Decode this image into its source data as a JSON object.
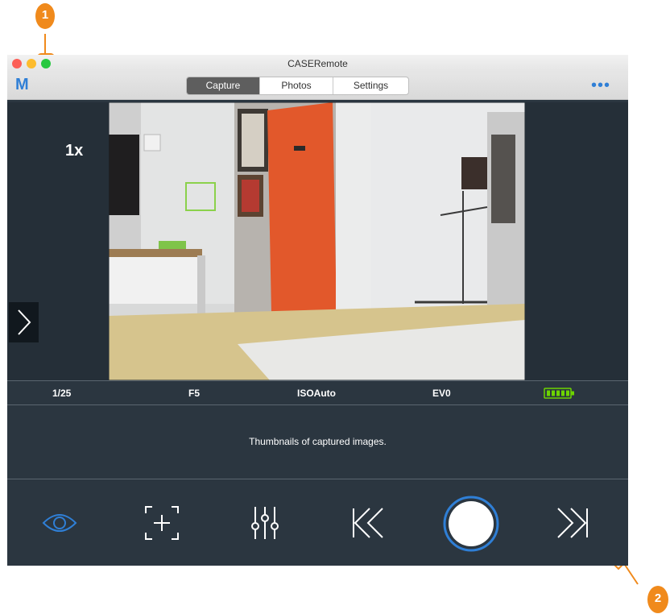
{
  "window": {
    "title": "CASERemote",
    "logo": "M",
    "more": "•••"
  },
  "tabs": [
    {
      "label": "Capture",
      "active": true
    },
    {
      "label": "Photos",
      "active": false
    },
    {
      "label": "Settings",
      "active": false
    }
  ],
  "preview": {
    "zoom": "1x",
    "next": "›"
  },
  "status": {
    "shutter": "1/25",
    "aperture": "F5",
    "iso": "ISOAuto",
    "ev": "EV0",
    "battery_color": "#6dd400"
  },
  "thumbnails": {
    "text": "Thumbnails of captured images."
  },
  "controls": [
    {
      "icon": "eye-icon"
    },
    {
      "icon": "focus-icon"
    },
    {
      "icon": "sliders-icon"
    },
    {
      "icon": "first-icon"
    },
    {
      "icon": "shutter-icon"
    },
    {
      "icon": "last-icon"
    }
  ],
  "annotations": {
    "one": "1",
    "two": "2",
    "color": "#f08a1c"
  },
  "colors": {
    "accent": "#2f7fd6"
  }
}
